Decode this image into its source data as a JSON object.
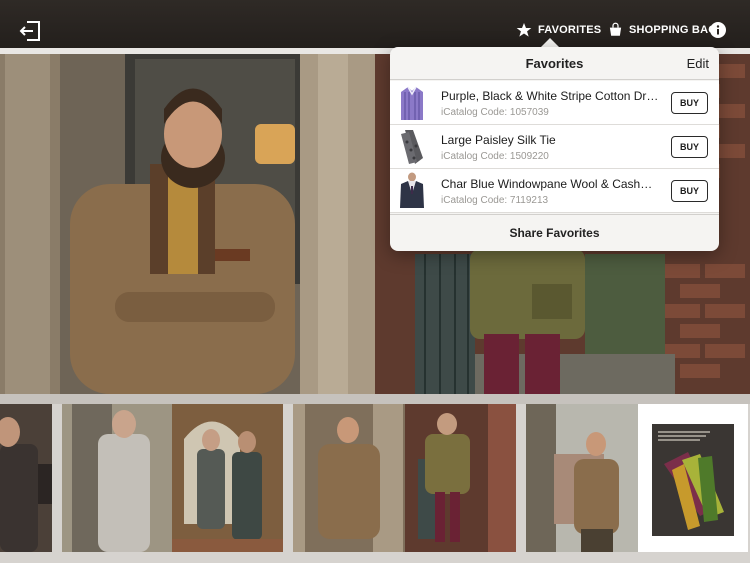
{
  "toolbar": {
    "exit_icon": "exit-icon",
    "favorites_label": "FAVORITES",
    "favorites_icon": "star-icon",
    "shopping_bag_label": "SHOPPING BAG",
    "shopping_bag_icon": "shopping-bag-icon",
    "info_icon": "info-icon"
  },
  "favorites_popover": {
    "title": "Favorites",
    "edit_label": "Edit",
    "items": [
      {
        "name": "Purple, Black & White Stripe Cotton Dress Shirt",
        "code": "iCatalog Code: 1057039",
        "buy_label": "BUY"
      },
      {
        "name": "Large Paisley Silk Tie",
        "code": "iCatalog Code: 1509220",
        "buy_label": "BUY"
      },
      {
        "name": "Char Blue Windowpane Wool & Cashmere Sport Coat",
        "code": "iCatalog Code: 7119213",
        "buy_label": "BUY"
      }
    ],
    "share_label": "Share Favorites"
  },
  "thumbnail_strip": {
    "pages": [
      {
        "label": "catalog-page-1"
      },
      {
        "label": "catalog-page-2"
      },
      {
        "label": "catalog-page-3"
      },
      {
        "label": "catalog-page-4"
      },
      {
        "label": "catalog-page-5"
      },
      {
        "label": "catalog-page-6"
      }
    ]
  },
  "colors": {
    "topbar": "#2a2521",
    "popover_bg": "#f5f4f2",
    "tweed": "#8a6d4c"
  }
}
